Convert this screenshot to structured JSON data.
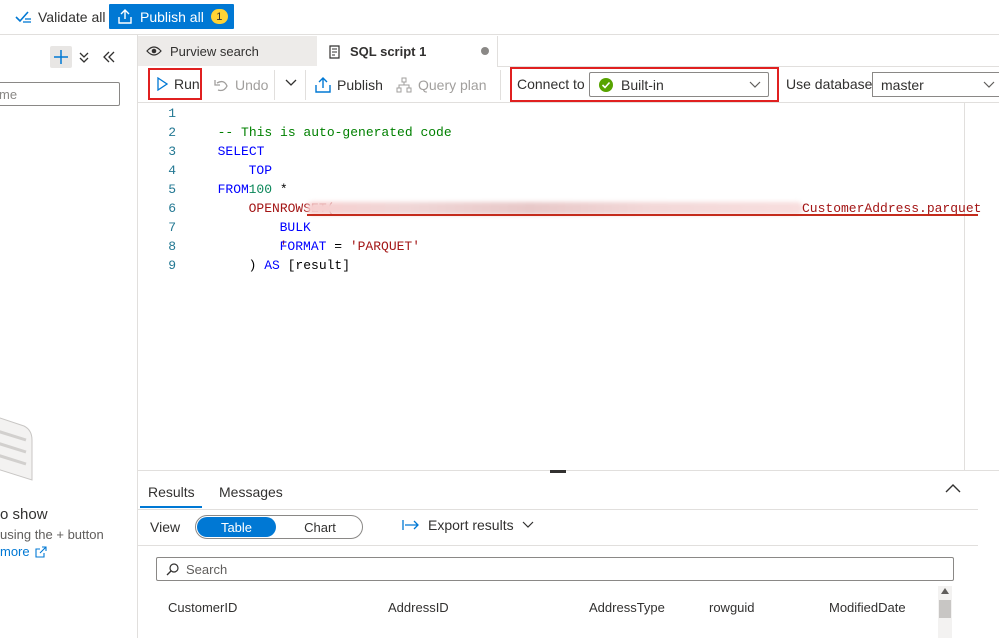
{
  "topbar": {
    "validate_label": "Validate all",
    "publish_label": "Publish all",
    "publish_count": "1"
  },
  "left": {
    "filter_placeholder": "me",
    "empty_title": "o show",
    "empty_sub": "using the + button",
    "empty_link": "more"
  },
  "tabs": [
    {
      "label": "Purview search",
      "icon": "eye-icon"
    },
    {
      "label": "SQL script 1",
      "icon": "script-icon"
    }
  ],
  "toolbar": {
    "run": "Run",
    "undo": "Undo",
    "publish": "Publish",
    "query_plan": "Query plan",
    "connect_to": "Connect to",
    "connect_value": "Built-in",
    "use_database": "Use database",
    "database_value": "master"
  },
  "editor": {
    "line_numbers": [
      "1",
      "2",
      "3",
      "4",
      "5",
      "6",
      "7",
      "8",
      "9"
    ],
    "line1_comment": "-- This is auto-generated code",
    "line2_select": "SELECT",
    "line3_top": "TOP",
    "line3_num": "100",
    "line3_star": " *",
    "line4_from": "FROM",
    "line5_openrowset": "OPENROWSET(",
    "line6_bulk": "BULK",
    "line6_quote": "'",
    "line6_file": "CustomerAddress.parquet",
    "line7_format": "FORMAT",
    "line7_eq": " = ",
    "line7_value": "'PARQUET'",
    "line8_close": ") ",
    "line8_as": "AS",
    "line8_result": " [result]"
  },
  "results": {
    "tab_results": "Results",
    "tab_messages": "Messages",
    "view_label": "View",
    "view_table": "Table",
    "view_chart": "Chart",
    "export": "Export results",
    "search_placeholder": "Search",
    "columns": [
      "CustomerID",
      "AddressID",
      "AddressType",
      "rowguid",
      "ModifiedDate"
    ]
  },
  "colors": {
    "accent": "#0078d4",
    "highlight_box": "#e02020",
    "connected": "#57a300",
    "badge": "#ffd335"
  }
}
